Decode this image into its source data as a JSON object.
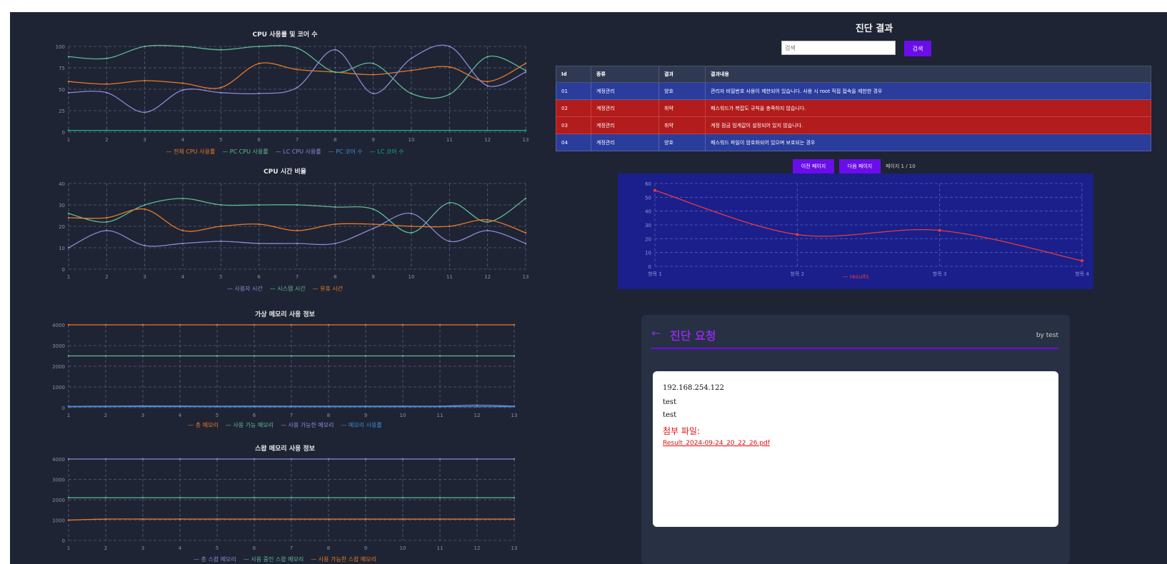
{
  "colors": {
    "orange": "#e8782a",
    "green": "#5fb897",
    "purple": "#8b8ad6",
    "blue": "#3d8bd8",
    "teal": "#1aa88c",
    "grid": "#56607a",
    "axis": "#8891a6",
    "accent": "#6a0dea"
  },
  "charts": [
    {
      "title": "CPU 사용률 및 코어 수",
      "xlabels": [
        "1",
        "2",
        "3",
        "4",
        "5",
        "6",
        "7",
        "8",
        "9",
        "10",
        "11",
        "12",
        "13"
      ],
      "ylim": [
        0,
        100
      ],
      "yticks": [
        "0",
        "25",
        "50",
        "75",
        "100"
      ],
      "series": [
        {
          "name": "전체 CPU 사용률",
          "color": "#e8782a",
          "values": [
            59,
            56,
            60,
            57,
            52,
            80,
            73,
            70,
            67,
            72,
            76,
            59,
            80
          ]
        },
        {
          "name": "PC CPU 사용률",
          "color": "#5fb897",
          "values": [
            88,
            86,
            100,
            100,
            96,
            100,
            98,
            70,
            80,
            45,
            44,
            88,
            72
          ]
        },
        {
          "name": "LC CPU 사용률",
          "color": "#8b8ad6",
          "values": [
            46,
            46,
            23,
            49,
            46,
            45,
            52,
            96,
            45,
            86,
            100,
            54,
            70
          ]
        },
        {
          "name": "PC 코어 수",
          "color": "#3d8bd8",
          "values": [
            2,
            2,
            2,
            2,
            2,
            2,
            2,
            2,
            2,
            2,
            2,
            2,
            2
          ]
        },
        {
          "name": "LC 코어 수",
          "color": "#1aa88c",
          "values": [
            2,
            2,
            2,
            2,
            2,
            2,
            2,
            2,
            2,
            2,
            2,
            2,
            2
          ]
        }
      ]
    },
    {
      "title": "CPU 시간 비율",
      "xlabels": [
        "1",
        "2",
        "3",
        "4",
        "5",
        "6",
        "7",
        "8",
        "9",
        "10",
        "11",
        "12",
        "13"
      ],
      "ylim": [
        0,
        40
      ],
      "yticks": [
        "0",
        "10",
        "20",
        "30",
        "40"
      ],
      "series": [
        {
          "name": "사용자 시간",
          "color": "#8b8ad6",
          "values": [
            10,
            18,
            11,
            12,
            13,
            12,
            12,
            12,
            19,
            26,
            13,
            18,
            12
          ]
        },
        {
          "name": "시스템 시간",
          "color": "#5fb897",
          "values": [
            26,
            22,
            30,
            33,
            30,
            30,
            30,
            29,
            28,
            17,
            31,
            22,
            33
          ]
        },
        {
          "name": "유휴 시간",
          "color": "#e8782a",
          "values": [
            24,
            24,
            28,
            18,
            20,
            21,
            18,
            21,
            21,
            20,
            20,
            23,
            17
          ]
        }
      ]
    },
    {
      "title": "가상 메모리 사용 정보",
      "xlabels": [
        "1",
        "2",
        "3",
        "4",
        "5",
        "6",
        "7",
        "8",
        "9",
        "10",
        "11",
        "12",
        "13"
      ],
      "ylim": [
        0,
        4000
      ],
      "yticks": [
        "0",
        "1000",
        "2000",
        "3000",
        "4000"
      ],
      "series": [
        {
          "name": "총 메모리",
          "color": "#e8782a",
          "values": [
            4000,
            4000,
            4000,
            4000,
            4000,
            4000,
            4000,
            4000,
            4000,
            4000,
            4000,
            4000,
            4000
          ]
        },
        {
          "name": "사용 가능 메모리",
          "color": "#5fb897",
          "values": [
            2500,
            2500,
            2500,
            2500,
            2500,
            2500,
            2500,
            2500,
            2500,
            2500,
            2500,
            2500,
            2500
          ]
        },
        {
          "name": "사용 가능한 메모리",
          "color": "#8b8ad6",
          "values": [
            60,
            70,
            80,
            75,
            70,
            72,
            70,
            68,
            70,
            72,
            70,
            120,
            70
          ]
        },
        {
          "name": "메모리 사용률",
          "color": "#3d8bd8",
          "values": [
            40,
            45,
            50,
            48,
            46,
            45,
            44,
            45,
            46,
            44,
            45,
            48,
            46
          ]
        }
      ]
    },
    {
      "title": "스왑 메모리 사용 정보",
      "xlabels": [
        "1",
        "2",
        "3",
        "4",
        "5",
        "6",
        "7",
        "8",
        "9",
        "10",
        "11",
        "12",
        "13"
      ],
      "ylim": [
        0,
        4000
      ],
      "yticks": [
        "0",
        "1000",
        "2000",
        "3000",
        "4000"
      ],
      "series": [
        {
          "name": "총 스왑 메모리",
          "color": "#8b8ad6",
          "values": [
            4000,
            4000,
            4000,
            4000,
            4000,
            4000,
            4000,
            4000,
            4000,
            4000,
            4000,
            4000,
            4000
          ]
        },
        {
          "name": "사용 중인 스왑 메모리",
          "color": "#5fb897",
          "values": [
            2100,
            2100,
            2100,
            2100,
            2100,
            2100,
            2100,
            2100,
            2100,
            2100,
            2100,
            2100,
            2100
          ]
        },
        {
          "name": "사용 가능한 스왑 메모리",
          "color": "#e8782a",
          "values": [
            1000,
            1050,
            1050,
            1050,
            1050,
            1050,
            1050,
            1050,
            1050,
            1050,
            1050,
            1050,
            1050
          ]
        }
      ]
    }
  ],
  "diagnosis": {
    "title": "진단 결과",
    "search_placeholder": "검색",
    "search_button": "검색",
    "table": {
      "headers": [
        "Id",
        "종류",
        "결과",
        "결과내용"
      ],
      "rows": [
        {
          "status": "blue",
          "cells": [
            "01",
            "계정관리",
            "양호",
            "관리자 비밀번호 사용이 제한되어 있습니다. 사용 시 root 직접 접속을 제한한 경우"
          ]
        },
        {
          "status": "red",
          "cells": [
            "02",
            "계정관리",
            "취약",
            "패스워드가 복잡도 규칙을 충족하지 않습니다."
          ]
        },
        {
          "status": "red",
          "cells": [
            "03",
            "계정관리",
            "취약",
            "계정 잠금 임계값이 설정되어 있지 않습니다."
          ]
        },
        {
          "status": "blue",
          "cells": [
            "04",
            "계정관리",
            "양호",
            "패스워드 파일이 암호화되어 있으며 보호되는 경우"
          ]
        }
      ]
    },
    "prev_button": "이전 페이지",
    "next_button": "다음 페이지",
    "page_info": "페이지 1 / 10"
  },
  "mini_chart": {
    "xlabels": [
      "항목 1",
      "항목 2",
      "항목 3",
      "항목 4"
    ],
    "ylim": [
      0,
      60
    ],
    "yticks": [
      "0",
      "10",
      "20",
      "30",
      "40",
      "50",
      "60"
    ],
    "series": [
      {
        "name": "results",
        "color": "#e83a3a",
        "values": [
          55,
          23,
          26,
          4
        ]
      }
    ]
  },
  "request": {
    "back_arrow": "←",
    "title": "진단 요청",
    "by": "by test",
    "ip": "192.168.254.122",
    "line1": "test",
    "line2": "test",
    "attachment_label": "첨부 파일:",
    "attachment_file": "Result_2024-09-24_20_22_26.pdf"
  }
}
